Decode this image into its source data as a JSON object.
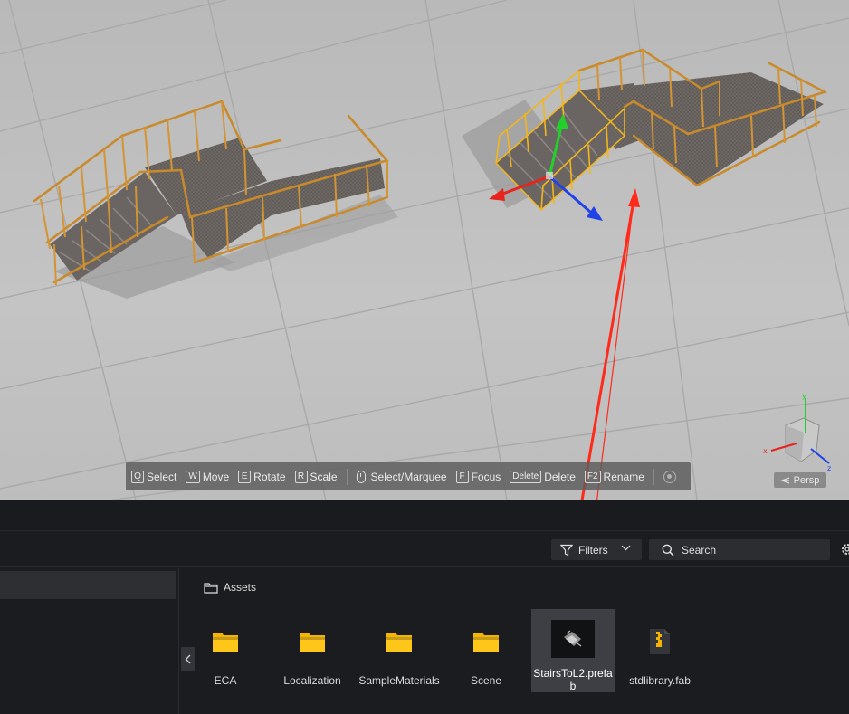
{
  "viewport": {
    "hud": {
      "select": {
        "key": "Q",
        "label": "Select"
      },
      "move": {
        "key": "W",
        "label": "Move"
      },
      "rotate": {
        "key": "E",
        "label": "Rotate"
      },
      "scale": {
        "key": "R",
        "label": "Scale"
      },
      "marquee": {
        "label": "Select/Marquee"
      },
      "focus": {
        "key": "F",
        "label": "Focus"
      },
      "delete": {
        "key": "Delete",
        "label": "Delete"
      },
      "rename": {
        "key": "F2",
        "label": "Rename"
      }
    },
    "camera_mode": "Persp",
    "gizmo_labels": {
      "x": "x",
      "y": "y",
      "z": "z"
    },
    "colors": {
      "axis_x": "#e8231e",
      "axis_y": "#22d02a",
      "axis_z": "#2142e6",
      "selection": "#f2b61c",
      "annotation_arrow": "#ff2a1a"
    }
  },
  "asset_browser": {
    "filters_label": "Filters",
    "search_placeholder": "Search",
    "breadcrumb": "Assets",
    "items": [
      {
        "name": "ECA",
        "type": "folder"
      },
      {
        "name": "Localization",
        "type": "folder"
      },
      {
        "name": "SampleMaterials",
        "type": "folder"
      },
      {
        "name": "Scene",
        "type": "folder"
      },
      {
        "name": "StairsToL2.prefab",
        "type": "prefab",
        "selected": true
      },
      {
        "name": "stdlibrary.fab",
        "type": "archive"
      }
    ]
  }
}
